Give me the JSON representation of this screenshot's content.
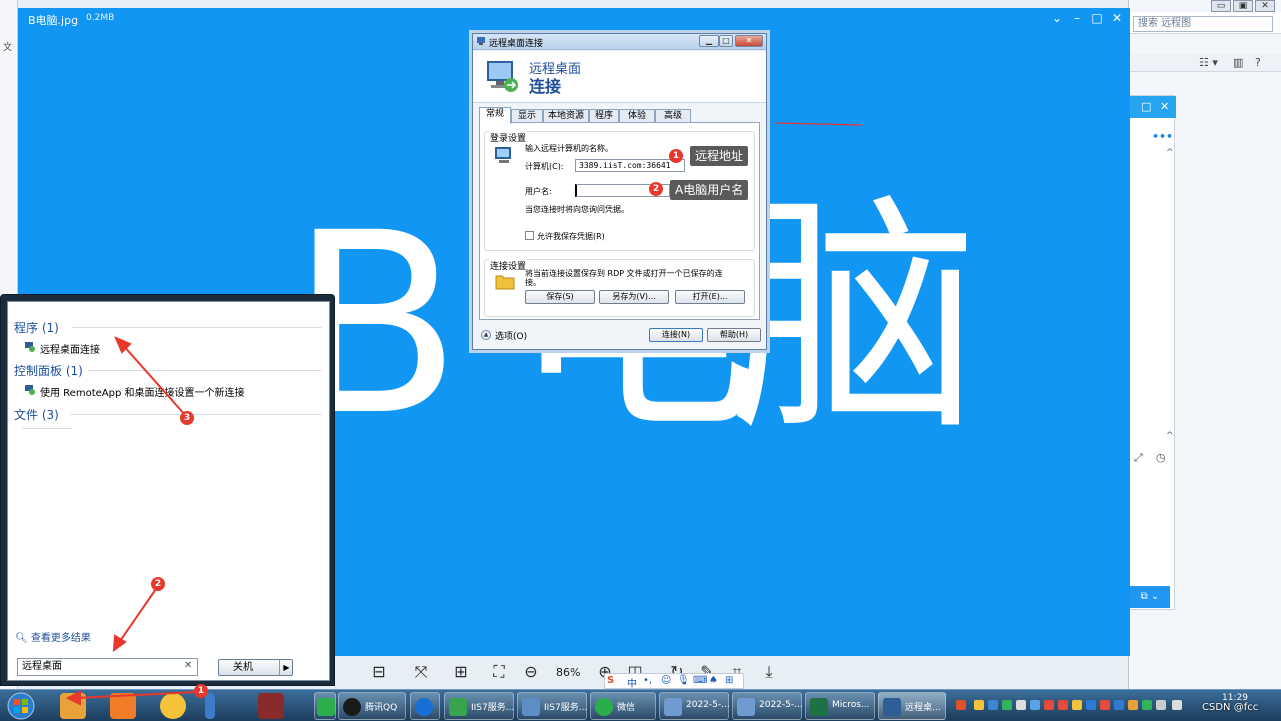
{
  "viewer": {
    "title": "B电脑.jpg",
    "size": "0.2MB",
    "image_text_b": "B",
    "image_text_dian": "电",
    "image_text_nao": "脑",
    "zoom": "86%"
  },
  "explorer_bg": {
    "search_placeholder": "搜索 远程图",
    "left_menu": "文",
    "panel_dots": "•••"
  },
  "rdp": {
    "window_title": "远程桌面连接",
    "banner_line1": "远程桌面",
    "banner_line2": "连接",
    "tabs": [
      "常规",
      "显示",
      "本地资源",
      "程序",
      "体验",
      "高级"
    ],
    "login_group": "登录设置",
    "enter_name_hint": "输入远程计算机的名称。",
    "computer_label": "计算机(C):",
    "computer_value": "3389.iisT.com:36641",
    "username_label": "用户名:",
    "username_value": "",
    "credential_hint": "当您连接时将向您询问凭据。",
    "allow_save_label": "允许我保存凭据(R)",
    "conn_group": "连接设置",
    "conn_hint_line1": "将当前连接设置保存到 RDP 文件或打开一个已保存的连",
    "conn_hint_line2": "接。",
    "save_btn": "保存(S)",
    "saveas_btn": "另存为(V)...",
    "open_btn": "打开(E)...",
    "options_label": "选项(O)",
    "connect_btn": "连接(N)",
    "help_btn": "帮助(H)"
  },
  "annotations": {
    "badge1": "1",
    "callout1": "远程地址",
    "badge2": "2",
    "callout2": "A电脑用户名",
    "badge3": "3",
    "start_badge1": "1",
    "start_badge2": "2"
  },
  "start_menu": {
    "programs_header": "程序 (1)",
    "program_item": "远程桌面连接",
    "control_header": "控制面板 (1)",
    "control_item": "使用 RemoteApp 和桌面连接设置一个新连接",
    "files_header": "文件 (3)",
    "more_results": "查看更多结果",
    "search_value": "远程桌面",
    "shutdown_label": "关机"
  },
  "taskbar": {
    "items": [
      "腾讯QQ",
      "IIS7服务...",
      "IIS7服务...",
      "微信",
      "2022-5-...",
      "2022-5-...",
      "Micros...",
      "远程桌..."
    ],
    "clock": "11:29",
    "watermark": "CSDN @fcc"
  },
  "ime": {
    "label": "中"
  },
  "colors": {
    "viewer_bg": "#1296f4",
    "badge": "#e8372b",
    "callout": "#5a5a5a",
    "link_blue": "#1c4f9c"
  }
}
